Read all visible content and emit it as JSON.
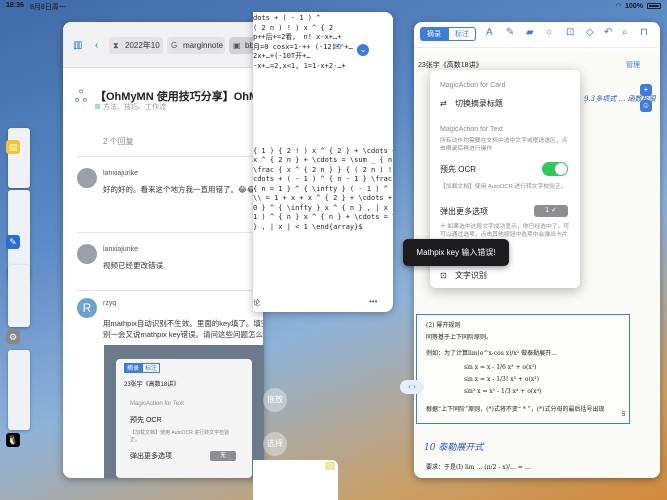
{
  "status": {
    "time": "18:36",
    "date": "8月8日周一",
    "battery": "100%"
  },
  "forum": {
    "tabs": [
      "2022年10",
      "marginnote",
      "bbs"
    ],
    "topic_title": "【OhMyMN 使用技巧分享】OhMy",
    "category": "方法、技巧、工作流",
    "replies": "2 个回复",
    "posts": [
      {
        "user": "lanxiajunke",
        "text": "好的好的。看来这个地方我一直用错了。😂😂"
      },
      {
        "user": "lanxiajunke",
        "text": "视频已经更改错误"
      },
      {
        "user": "rzyq",
        "text1": "用mathpix自动识别不生效。里面的key填了。填完",
        "text2": "别一会又说mathpix key错误。请问这些问题怎么"
      }
    ],
    "avatar_letter": "R",
    "embed": {
      "seg": [
        "摘录",
        "标注"
      ],
      "doc": "23张宇《高数18讲》",
      "hdr": "MagicAction for Text",
      "ocr": "预先 OCR",
      "desc": "【加载文档】使用 AutoOCR 进行转文字检验正。",
      "more": "弹出更多选项",
      "val": "无"
    }
  },
  "math": {
    "lines": [
      "dots + ( - 1 ) ^",
      "( 2 n ) ! ) x ^ { 2",
      "p++后+=2看，  n! x-x+…+",
      "月=0 cosx=1-++  (-12)²ⁿ+…",
      "2x+…+(-10T开+…",
      "-x+…=2,x<1, 1=1-x+2-…+",
      "",
      "{ 1 ) { 2 ! ) x ^ { 2 } + \\cdots + ( -",
      "x ^ { 2 n } + \\cdots = \\sum _ { n",
      "\\frac { x ^ { 2 n } } { ( 2 n ) ! } \\\\ x ) =",
      "cdots + ( - 1 ) ^ { n - 1 } \\frac { x ^",
      "{ n = 1 } ^ { \\infty } ( - 1 ) ^ { n - 1 }",
      "\\\\ = 1 + x + x ^ { 2 } + \\cdots + x ^",
      "0 } ^ { \\infty } x ^ { n } , | x | < 1 \\\\ =",
      "1 ) ^ { n } x ^ { n } + \\cdots = \\sum",
      "} , | x | < 1 \\end{array}$"
    ],
    "footer": "论",
    "actions": [
      "拖放",
      "选择"
    ]
  },
  "app": {
    "seg": [
      "摘录",
      "标注"
    ],
    "doc_title": "23张宇《高数18讲》",
    "manage": "管理",
    "popover": {
      "hdr_card": "MagicAction for Card",
      "switch_title": "切换摘录标题",
      "hdr_text": "MagicAction for Text",
      "desc_text": "所有动作均需要在文档中选中文字或框选选区，点击摘录后再进行操作",
      "pre_ocr": "预先 OCR",
      "ocr_desc": "【加载文档】使用 AutoOCR 进行转文字校验正。",
      "more_opts": "弹出更多选项",
      "stepper_val": "1",
      "more_desc": "十 如果选中这段文字成功显示，你已经选中了，可可以通过选项，点击其他按钮中选项中会弹出卡片中。",
      "text_recog": "文字识别"
    },
    "toast": "Mathpix key 输入错误!",
    "page_num": "5",
    "doc_lines": [
      "(2) 幂开规则",
      "同等基于上下同阶原则。",
      "例如：为了计算lim(e^x-cos x)/x² 做泰勒展开…",
      "sin x = x - 1/6 x³ + o(x³)",
      "sin x = x - 1/3! x³ + o(x³)",
      "sin² x = x² - 1/3 x⁴ + o(x⁴)",
      "根据“上下同阶”原则，(*)式将不变“ * ”，(*)式分母的最后括号出现",
      "要求：于是(I) lim … (π/2 - x)/… = …"
    ],
    "hand_notes": [
      "10 泰勒展开式",
      "9.3多项式 … 函数极限"
    ]
  }
}
